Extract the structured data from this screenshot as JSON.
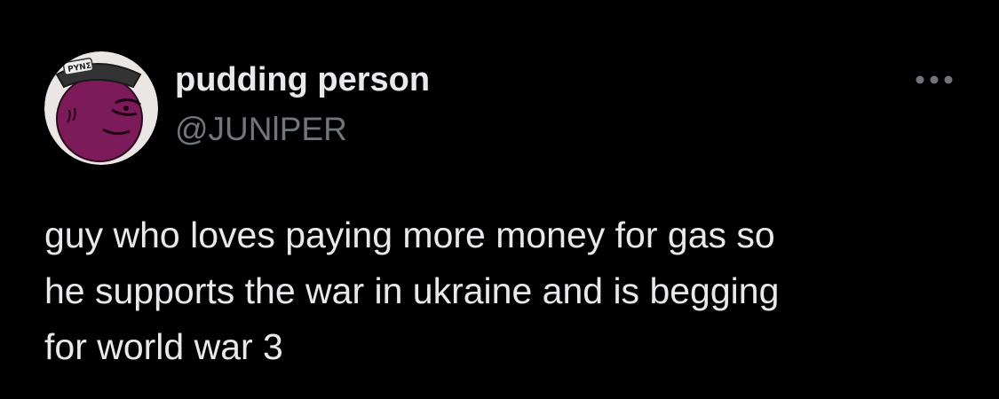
{
  "tweet": {
    "author": {
      "display_name": "pudding person",
      "handle": "@JUNlPER",
      "avatar_icon": "profile-avatar-icon",
      "avatar_hat_text": "ΡΥΝΣ"
    },
    "more_icon": "more-options-icon",
    "text": "guy who loves paying more money for gas so\nhe supports the war in ukraine and is begging\nfor world war 3"
  },
  "colors": {
    "background": "#000000",
    "primary_text": "#e7e9ea",
    "secondary_text": "#71767b",
    "avatar_fill": "#7d1a5a",
    "avatar_bg": "#e9e6e3"
  }
}
